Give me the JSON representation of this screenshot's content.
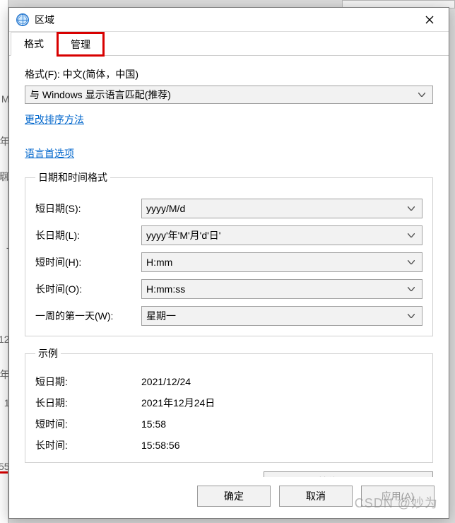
{
  "window": {
    "title": "区域",
    "close_aria": "关闭"
  },
  "tabs": {
    "format": "格式",
    "admin": "管理"
  },
  "format_section": {
    "format_label": "格式(F): 中文(简体，中国)",
    "format_select_value": "与 Windows 显示语言匹配(推荐)"
  },
  "links": {
    "sort_method": "更改排序方法",
    "language_prefs": "语言首选项"
  },
  "dt_fieldset": {
    "legend": "日期和时间格式",
    "short_date_label": "短日期(S):",
    "short_date_value": "yyyy/M/d",
    "long_date_label": "长日期(L):",
    "long_date_value": "yyyy'年'M'月'd'日'",
    "short_time_label": "短时间(H):",
    "short_time_value": "H:mm",
    "long_time_label": "长时间(O):",
    "long_time_value": "H:mm:ss",
    "first_day_label": "一周的第一天(W):",
    "first_day_value": "星期一"
  },
  "examples_fieldset": {
    "legend": "示例",
    "short_date_label": "短日期:",
    "short_date_value": "2021/12/24",
    "long_date_label": "长日期:",
    "long_date_value": "2021年12月24日",
    "short_time_label": "短时间:",
    "short_time_value": "15:58",
    "long_time_label": "长时间:",
    "long_time_value": "15:58:56"
  },
  "buttons": {
    "other_settings": "其他设置(D)...",
    "ok": "确定",
    "cancel": "取消",
    "apply": "应用(A)"
  },
  "watermark": "CSDN @妙为",
  "bg_left_snippets": [
    "M",
    "年",
    "㍼",
    "-",
    "12",
    "年1",
    "55"
  ]
}
